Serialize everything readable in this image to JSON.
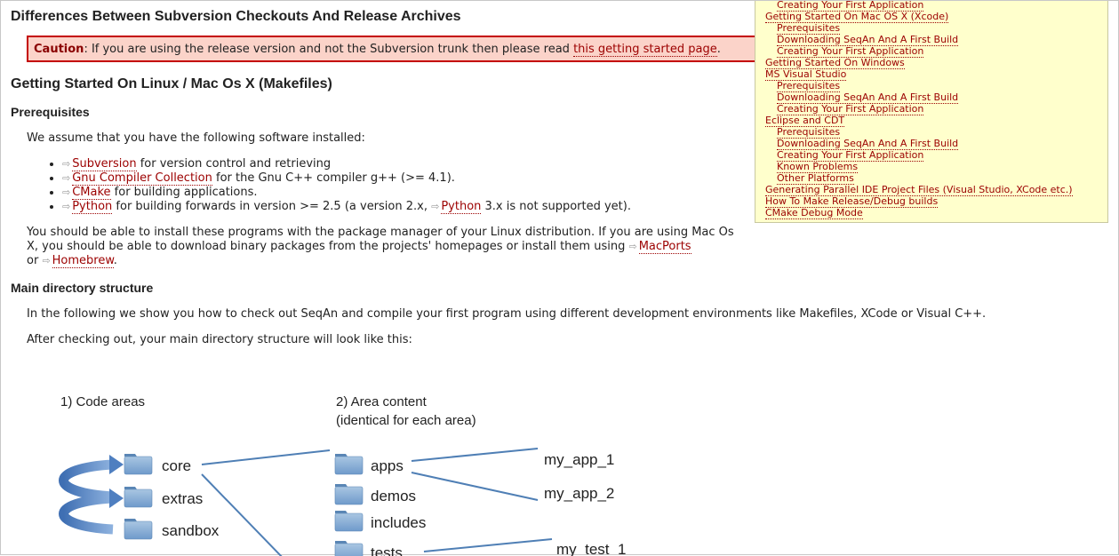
{
  "heading": "Differences Between Subversion Checkouts And Release Archives",
  "caution": {
    "label": "Caution",
    "text_before": ": If you are using the release version and not the Subversion trunk then please read ",
    "link": "this getting started page",
    "text_after": "."
  },
  "linux_heading": "Getting Started On Linux / Mac Os X (Makefiles)",
  "prereq_heading": "Prerequisites",
  "prereq_intro": "We assume that you have the following software installed:",
  "prereq_items": [
    {
      "link": "Subversion",
      "text": " for version control and retrieving"
    },
    {
      "link": "Gnu Compiler Collection",
      "text": " for the Gnu C++ compiler g++ (>= 4.1)."
    },
    {
      "link": "CMake",
      "text": " for building applications."
    },
    {
      "link": "Python",
      "text": " for building forwards in version >= 2.5 (a version 2.x, ",
      "link2": "Python",
      "text2": " 3.x is not supported yet)."
    }
  ],
  "install_text_1": "You should be able to install these programs with the package manager of your Linux distribution. If you are using Mac Os X, you should be able to download binary packages from the projects' homepages or install them using ",
  "install_link_1": "MacPorts",
  "install_text_2": "or ",
  "install_link_2": "Homebrew",
  "install_text_3": ".",
  "dir_heading": "Main directory structure",
  "dir_p1": "In the following we show you how to check out SeqAn and compile your first program using different development environments like Makefiles, XCode or Visual C++.",
  "dir_p2": "After checking out, your main directory structure will look like this:",
  "ext_icon": "⇨",
  "toc": [
    {
      "label": "Creating Your First Application",
      "level": 1
    },
    {
      "label": "Getting Started On Mac OS X (Xcode)",
      "level": 0
    },
    {
      "label": "Prerequisites",
      "level": 1
    },
    {
      "label": "Downloading SeqAn And A First Build",
      "level": 1
    },
    {
      "label": "Creating Your First Application",
      "level": 1
    },
    {
      "label": "Getting Started On Windows",
      "level": 0
    },
    {
      "label": "MS Visual Studio",
      "level": 0
    },
    {
      "label": "Prerequisites",
      "level": 1
    },
    {
      "label": "Downloading SeqAn And A First Build",
      "level": 1
    },
    {
      "label": "Creating Your First Application",
      "level": 1
    },
    {
      "label": "Eclipse and CDT",
      "level": 0
    },
    {
      "label": "Prerequisites",
      "level": 1
    },
    {
      "label": "Downloading SeqAn And A First Build",
      "level": 1
    },
    {
      "label": "Creating Your First Application",
      "level": 1
    },
    {
      "label": "Known Problems",
      "level": 1
    },
    {
      "label": "Other Platforms",
      "level": 1
    },
    {
      "label": "Generating Parallel IDE Project Files (Visual Studio, XCode etc.)",
      "level": 0
    },
    {
      "label": "How To Make Release/Debug builds",
      "level": 0
    },
    {
      "label": "CMake Debug Mode",
      "level": 0
    }
  ],
  "diagram": {
    "code_areas_title": "1) Code areas",
    "area_content_title_1": "2) Area content",
    "area_content_title_2": "(identical for each area)",
    "code_areas": [
      "core",
      "extras",
      "sandbox"
    ],
    "area_content": [
      "apps",
      "demos",
      "includes",
      "tests"
    ],
    "apps_children": [
      "my_app_1",
      "my_app_2"
    ],
    "tests_children": [
      "my_test_1"
    ],
    "colors": {
      "folder": "#7fa7cf",
      "folder_dark": "#5a86b5",
      "line": "#4f7fb5",
      "arrow": "#4f7fc0"
    }
  }
}
